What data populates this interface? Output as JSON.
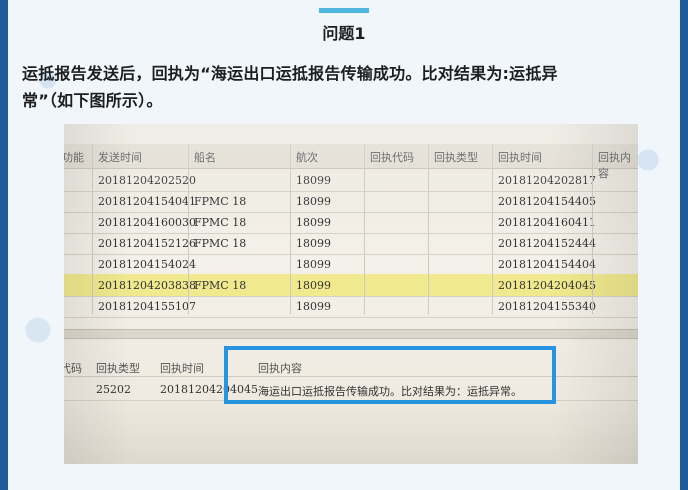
{
  "heading": "问题1",
  "description_line1": "运抵报告发送后，回执为“海运出口运抵报告传输成功。比对结果为:运抵异",
  "description_line2": "常”（如下图所示）。",
  "table": {
    "headers": [
      "功能",
      "发送时间",
      "船名",
      "航次",
      "回执代码",
      "回执类型",
      "回执时间",
      "回执内容"
    ],
    "rows": [
      {
        "send_time": "20181204202520",
        "ship": "",
        "voyage": "18099",
        "receipt_time": "20181204202817",
        "highlight": false
      },
      {
        "send_time": "20181204154041",
        "ship": "FPMC 18",
        "voyage": "18099",
        "receipt_time": "20181204154405",
        "highlight": false
      },
      {
        "send_time": "20181204160030",
        "ship": "FPMC 18",
        "voyage": "18099",
        "receipt_time": "20181204160411",
        "highlight": false
      },
      {
        "send_time": "20181204152126",
        "ship": "FPMC 18",
        "voyage": "18099",
        "receipt_time": "20181204152444",
        "highlight": false
      },
      {
        "send_time": "20181204154024",
        "ship": "",
        "voyage": "18099",
        "receipt_time": "20181204154404",
        "highlight": false
      },
      {
        "send_time": "20181204203838",
        "ship": "FPMC 18",
        "voyage": "18099",
        "receipt_time": "20181204204045",
        "highlight": true
      },
      {
        "send_time": "20181204155107",
        "ship": "",
        "voyage": "18099",
        "receipt_time": "20181204155340",
        "highlight": false
      }
    ]
  },
  "detail": {
    "headers": [
      "代码",
      "回执类型",
      "回执时间",
      "回执内容"
    ],
    "code": "",
    "receipt_type": "25202",
    "receipt_time": "20181204204045",
    "receipt_content": "海运出口运抵报告传输成功。比对结果为：运抵异常。"
  },
  "colors": {
    "highlight_box": "#2694e0",
    "accent_bar": "#4fb6df",
    "page_border": "#1d5c9c"
  }
}
